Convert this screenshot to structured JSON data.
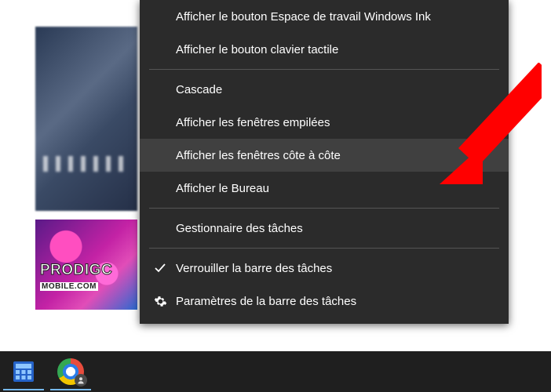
{
  "background": {
    "logo_main": "PRODIGC",
    "logo_sub": "MOBILE.COM"
  },
  "menu": {
    "items": [
      {
        "label": "Afficher le bouton Espace de travail Windows Ink",
        "icon": null,
        "hover": false,
        "sep_after": false
      },
      {
        "label": "Afficher le bouton clavier tactile",
        "icon": null,
        "hover": false,
        "sep_after": true
      },
      {
        "label": "Cascade",
        "icon": null,
        "hover": false,
        "sep_after": false
      },
      {
        "label": "Afficher les fenêtres empilées",
        "icon": null,
        "hover": false,
        "sep_after": false
      },
      {
        "label": "Afficher les fenêtres côte à côte",
        "icon": null,
        "hover": true,
        "sep_after": false
      },
      {
        "label": "Afficher le Bureau",
        "icon": null,
        "hover": false,
        "sep_after": true
      },
      {
        "label": "Gestionnaire des tâches",
        "icon": null,
        "hover": false,
        "sep_after": true
      },
      {
        "label": "Verrouiller la barre des tâches",
        "icon": "check-icon",
        "hover": false,
        "sep_after": false
      },
      {
        "label": "Paramètres de la barre des tâches",
        "icon": "gear-icon",
        "hover": false,
        "sep_after": false
      }
    ]
  },
  "taskbar": {
    "buttons": [
      {
        "name": "calculator-app",
        "icon": "calculator-icon",
        "active": true
      },
      {
        "name": "chrome-app",
        "icon": "chrome-icon",
        "active": true
      }
    ]
  },
  "annotation": {
    "arrow_color": "#ff0000"
  }
}
